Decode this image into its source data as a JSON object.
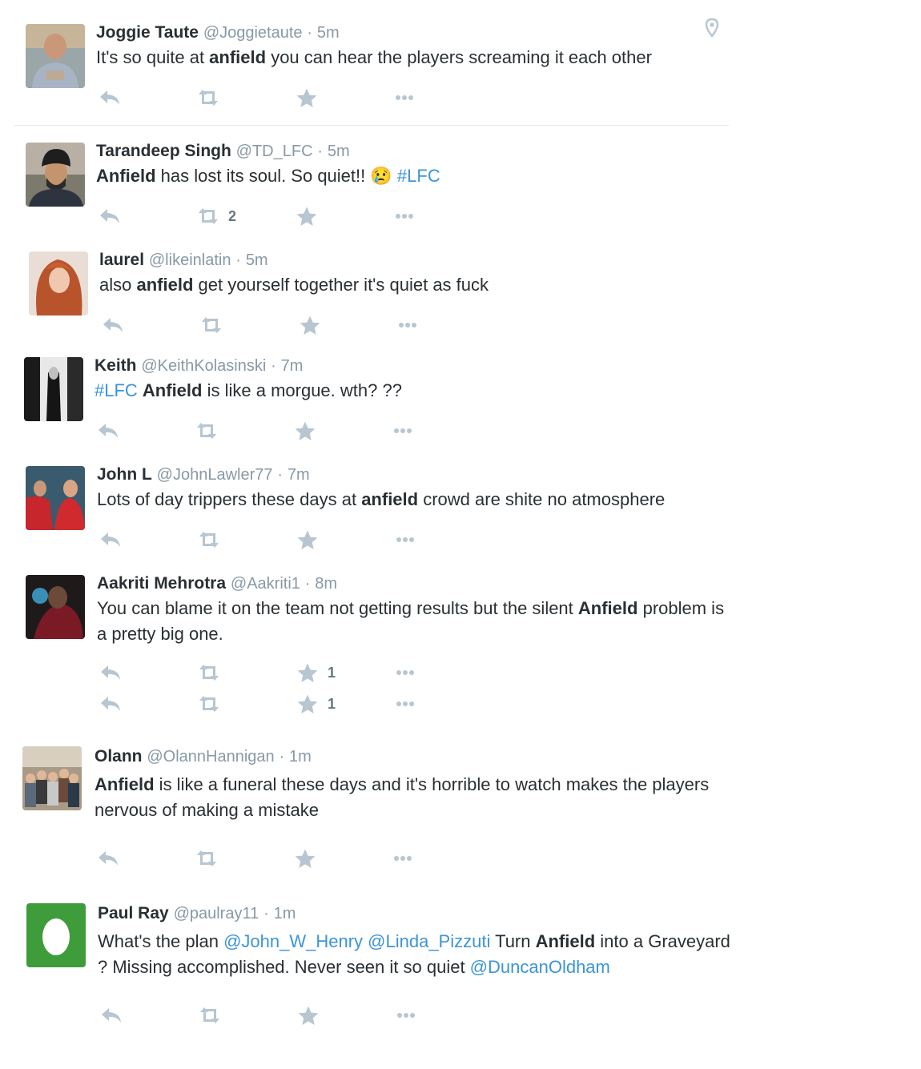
{
  "colors": {
    "name": "#292f33",
    "meta": "#8899a6",
    "link": "#3b94d9",
    "action_icon": "#b7c6d1",
    "divider": "#e1e8ed",
    "avatar_egg_bg": "#3f9c3a"
  },
  "icons": {
    "reply": "reply-icon",
    "retweet": "retweet-icon",
    "favorite": "star-icon",
    "more": "more-dots-icon",
    "location": "location-pin-icon"
  },
  "tweets": [
    {
      "name": "Joggie Taute",
      "handle": "@Joggietaute",
      "sep": "·",
      "time": "5m",
      "text": [
        {
          "t": "It's so quite at "
        },
        {
          "t": "anfield",
          "b": true
        },
        {
          "t": " you can hear the players screaming it each other"
        }
      ],
      "retweets": "",
      "favorites": ""
    },
    {
      "name": "Tarandeep Singh",
      "handle": "@TD_LFC",
      "sep": "·",
      "time": "5m",
      "text": [
        {
          "t": "Anfield",
          "b": true
        },
        {
          "t": " has lost its soul. So quiet!! "
        },
        {
          "t": "😢",
          "emoji": true
        },
        {
          "t": " "
        },
        {
          "t": "#LFC",
          "link": true
        }
      ],
      "retweets": "2",
      "favorites": ""
    },
    {
      "name": "laurel",
      "handle": "@likeinlatin",
      "sep": "·",
      "time": "5m",
      "text": [
        {
          "t": "also "
        },
        {
          "t": "anfield",
          "b": true
        },
        {
          "t": " get yourself together it's quiet as fuck"
        }
      ],
      "retweets": "",
      "favorites": ""
    },
    {
      "name": "Keith",
      "handle": "@KeithKolasinski",
      "sep": "·",
      "time": "7m",
      "text": [
        {
          "t": "#LFC",
          "link": true
        },
        {
          "t": " "
        },
        {
          "t": "Anfield",
          "b": true
        },
        {
          "t": " is like a morgue. wth? ??"
        }
      ],
      "retweets": "",
      "favorites": ""
    },
    {
      "name": "John L",
      "handle": "@JohnLawler77",
      "sep": "·",
      "time": "7m",
      "text": [
        {
          "t": "Lots of day trippers these days at "
        },
        {
          "t": "anfield",
          "b": true
        },
        {
          "t": " crowd are shite no atmosphere"
        }
      ],
      "retweets": "",
      "favorites": ""
    },
    {
      "name": "Aakriti Mehrotra",
      "handle": "@Aakriti1",
      "sep": "·",
      "time": "8m",
      "text": [
        {
          "t": "You can blame it on the team not getting results but the silent "
        },
        {
          "t": "Anfield",
          "b": true
        },
        {
          "t": " problem is a pretty big one."
        }
      ],
      "retweets": "",
      "favorites": "1",
      "extra_favorites": "1"
    },
    {
      "name": "Olann",
      "handle": "@OlannHannigan",
      "sep": "·",
      "time": "1m",
      "text": [
        {
          "t": "Anfield",
          "b": true
        },
        {
          "t": " is like a funeral these days and it's horrible to watch makes the players nervous of making a mistake"
        }
      ],
      "retweets": "",
      "favorites": ""
    },
    {
      "name": "Paul Ray",
      "handle": "@paulray11",
      "sep": "·",
      "time": "1m",
      "text": [
        {
          "t": "What's the plan "
        },
        {
          "t": "@John_W_Henry",
          "link": true
        },
        {
          "t": " "
        },
        {
          "t": "@Linda_Pizzuti",
          "link": true
        },
        {
          "t": " Turn "
        },
        {
          "t": "Anfield",
          "b": true
        },
        {
          "t": " into a Graveyard ? Missing accomplished. Never seen it so quiet "
        },
        {
          "t": "@DuncanOldham",
          "link": true
        }
      ],
      "retweets": "",
      "favorites": ""
    }
  ]
}
